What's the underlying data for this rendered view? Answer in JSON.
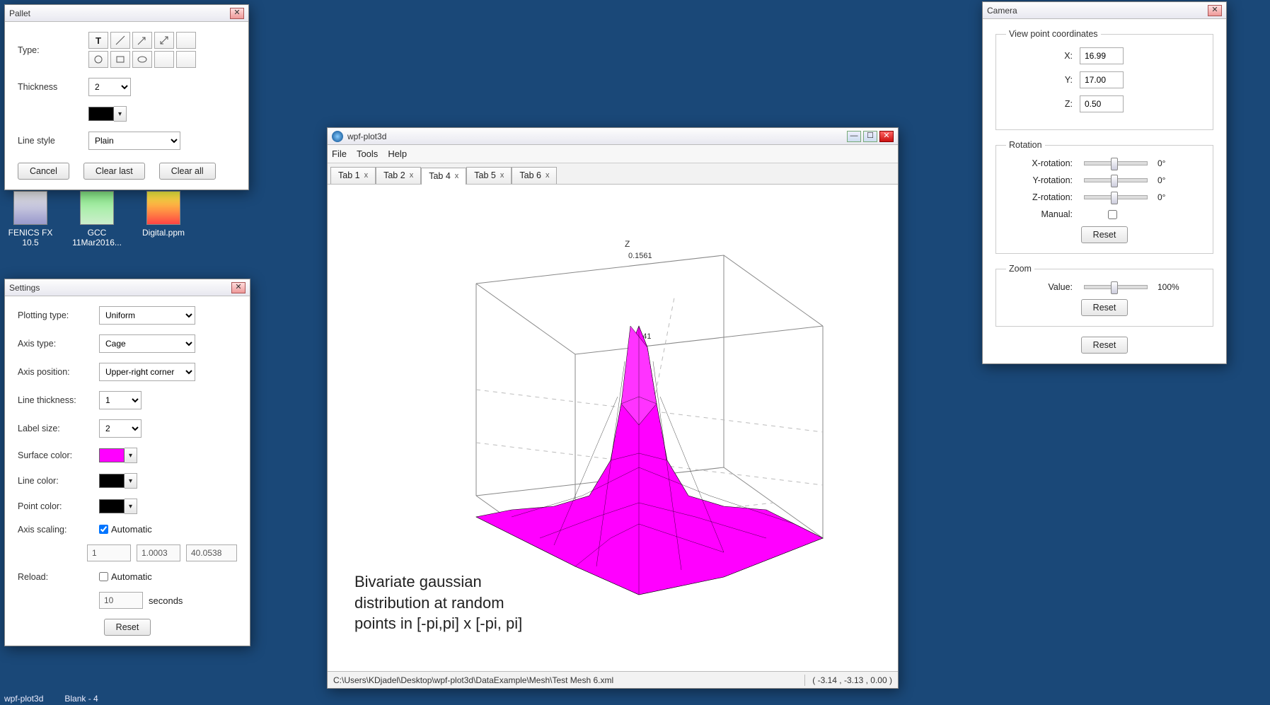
{
  "desktop": {
    "icons": [
      {
        "label": "FENICS FX 10.5"
      },
      {
        "label": "GCC 11Mar2016..."
      },
      {
        "label": "Digital.ppm"
      }
    ]
  },
  "taskbar": {
    "a": "wpf-plot3d",
    "b": "Blank - 4"
  },
  "pallet": {
    "title": "Pallet",
    "type_label": "Type:",
    "thickness_label": "Thickness",
    "thickness_value": "2",
    "linestyle_label": "Line style",
    "linestyle_value": "Plain",
    "color_hex": "#000000",
    "cancel": "Cancel",
    "clear_last": "Clear last",
    "clear_all": "Clear all"
  },
  "settings": {
    "title": "Settings",
    "plotting_type_label": "Plotting type:",
    "plotting_type_value": "Uniform",
    "axis_type_label": "Axis type:",
    "axis_type_value": "Cage",
    "axis_position_label": "Axis position:",
    "axis_position_value": "Upper-right corner",
    "line_thickness_label": "Line thickness:",
    "line_thickness_value": "1",
    "label_size_label": "Label size:",
    "label_size_value": "2",
    "surface_color_label": "Surface color:",
    "surface_color_hex": "#ff00ff",
    "line_color_label": "Line color:",
    "line_color_hex": "#000000",
    "point_color_label": "Point color:",
    "point_color_hex": "#000000",
    "axis_scaling_label": "Axis scaling:",
    "automatic": "Automatic",
    "scale_x": "1",
    "scale_y": "1.0003",
    "scale_z": "40.0538",
    "reload_label": "Reload:",
    "reload_value": "10",
    "seconds": "seconds",
    "reset": "Reset"
  },
  "mainwin": {
    "title": "wpf-plot3d",
    "menu": {
      "file": "File",
      "tools": "Tools",
      "help": "Help"
    },
    "tabs": [
      {
        "label": "Tab 1"
      },
      {
        "label": "Tab 2"
      },
      {
        "label": "Tab 4"
      },
      {
        "label": "Tab 5"
      },
      {
        "label": "Tab 6"
      }
    ],
    "active_tab": 2,
    "chart_caption": "Bivariate gaussian distribution at random points in [-pi,pi] x [-pi, pi]",
    "status_path": "C:\\Users\\KDjadel\\Desktop\\wpf-plot3d\\DataExample\\Mesh\\Test Mesh 6.xml",
    "status_coords": "( -3.14 , -3.13 , 0.00 )",
    "axis_labels": {
      "z": "Z",
      "z_top": "0.1561",
      "z_mid": "0.041"
    }
  },
  "camera": {
    "title": "Camera",
    "vp_legend": "View point coordinates",
    "x_label": "X:",
    "x_value": "16.99",
    "y_label": "Y:",
    "y_value": "17.00",
    "z_label": "Z:",
    "z_value": "0.50",
    "rot_legend": "Rotation",
    "xrot_label": "X-rotation:",
    "xrot_value": "0°",
    "yrot_label": "Y-rotation:",
    "yrot_value": "0°",
    "zrot_label": "Z-rotation:",
    "zrot_value": "0°",
    "manual_label": "Manual:",
    "reset": "Reset",
    "zoom_legend": "Zoom",
    "zoom_label": "Value:",
    "zoom_value": "100%"
  },
  "chart_data": {
    "type": "surface",
    "description": "Bivariate gaussian distribution sampled at random points over [-π,π]×[-π,π], rendered as a triangulated 3D mesh.",
    "x_range": [
      -3.14,
      3.14
    ],
    "y_range": [
      -3.13,
      3.13
    ],
    "z_range": [
      0.0,
      0.1561
    ],
    "z_ticks": [
      0.041,
      0.1561
    ],
    "surface_color": "#ff00ff",
    "wire_color": "#000000",
    "axis_type": "Cage",
    "view": {
      "X": 16.99,
      "Y": 17.0,
      "Z": 0.5,
      "zoom_pct": 100,
      "rot_deg": [
        0,
        0,
        0
      ]
    }
  }
}
